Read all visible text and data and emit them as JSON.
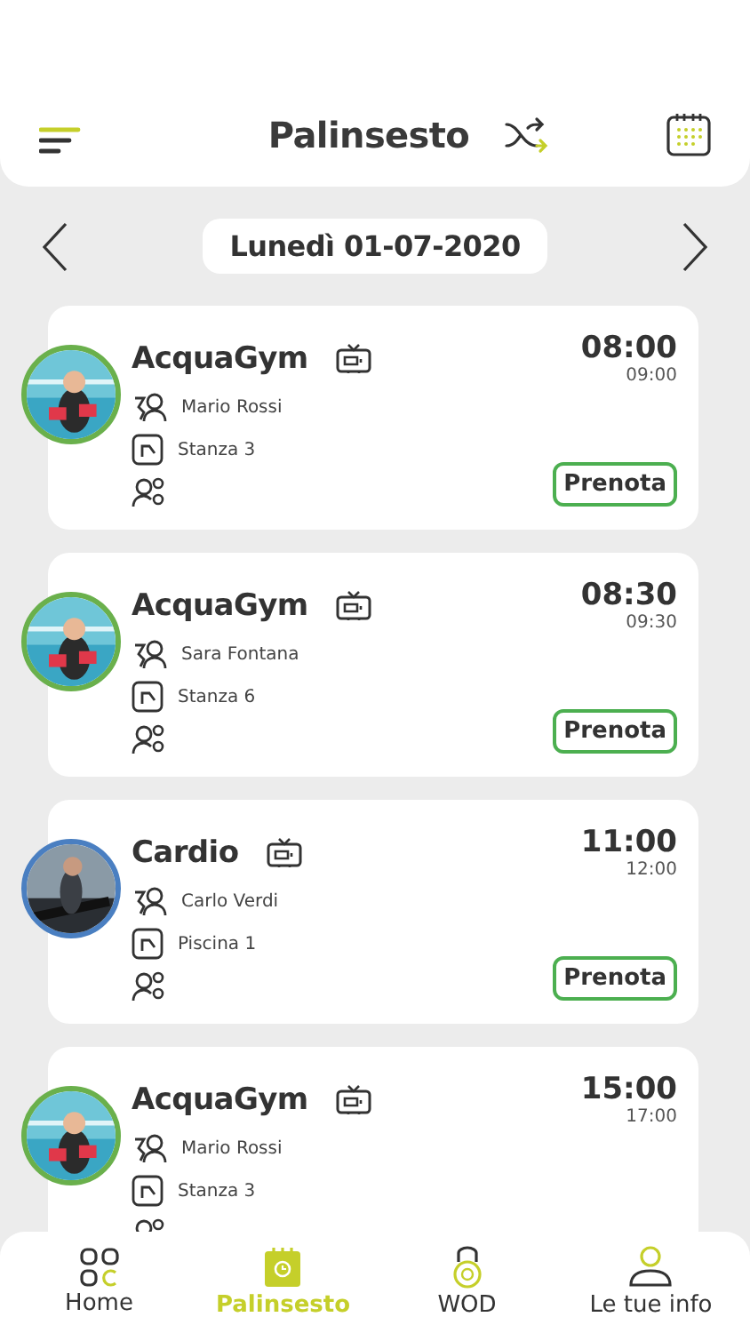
{
  "header": {
    "title": "Palinsesto"
  },
  "date_nav": {
    "date": "Lunedì 01-07-2020"
  },
  "classes": [
    {
      "name": "AcquaGym",
      "start": "08:00",
      "end": "09:00",
      "instructor": "Mario Rossi",
      "room": "Stanza 3",
      "color": "#6ab04c",
      "button": "Prenota"
    },
    {
      "name": "AcquaGym",
      "start": "08:30",
      "end": "09:30",
      "instructor": "Sara Fontana",
      "room": "Stanza 6",
      "color": "#6ab04c",
      "button": "Prenota"
    },
    {
      "name": "Cardio",
      "start": "11:00",
      "end": "12:00",
      "instructor": "Carlo Verdi",
      "room": "Piscina 1",
      "color": "#4a7fc1",
      "button": "Prenota"
    },
    {
      "name": "AcquaGym",
      "start": "15:00",
      "end": "17:00",
      "instructor": "Mario Rossi",
      "room": "Stanza 3",
      "color": "#6ab04c"
    }
  ],
  "tab_bar": [
    {
      "kind": "home",
      "label": "Home",
      "selected": false
    },
    {
      "kind": "schedule",
      "label": "Palinsesto",
      "selected": true
    },
    {
      "kind": "wod",
      "label": "WOD",
      "selected": false
    },
    {
      "kind": "profile",
      "label": "Le tue info",
      "selected": false
    }
  ]
}
